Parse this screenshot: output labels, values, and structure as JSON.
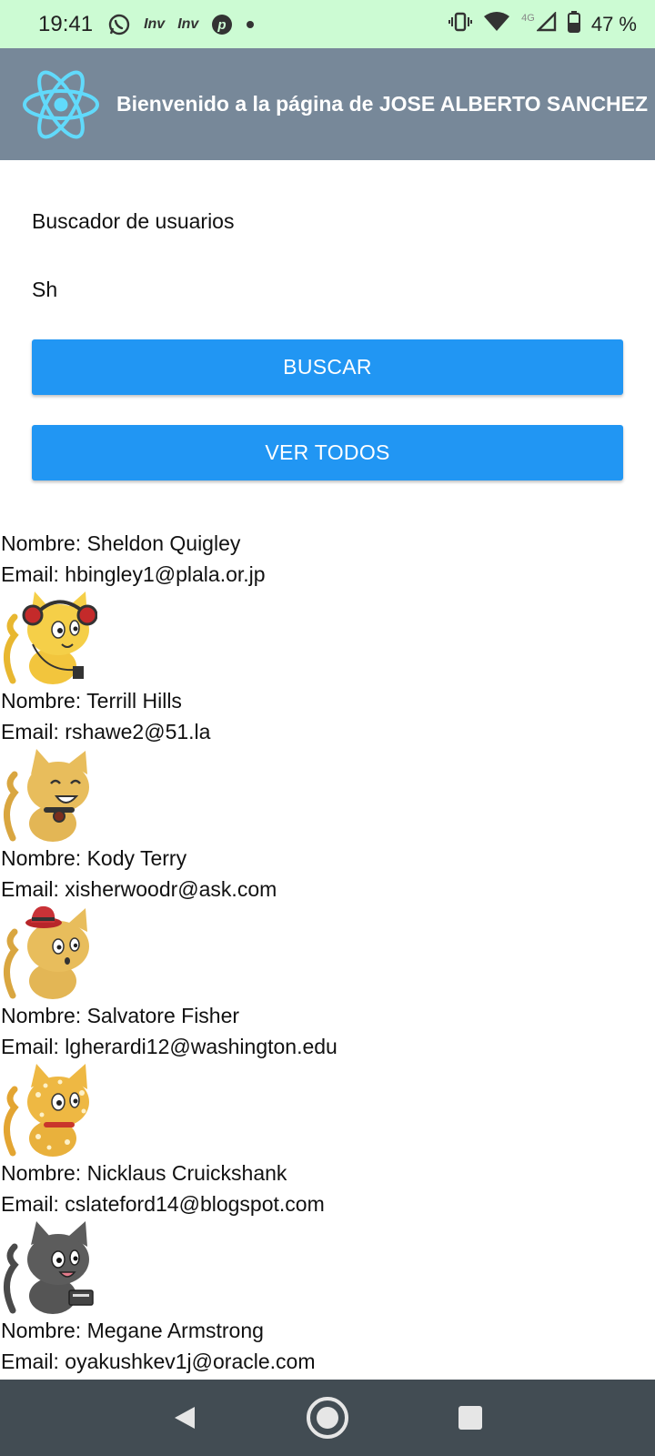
{
  "status_bar": {
    "time": "19:41",
    "notification_icons": [
      "whatsapp-icon",
      "inv-icon",
      "inv-icon",
      "pinterest-icon",
      "dot-icon"
    ],
    "inv_label": "Inv",
    "network_label": "4G",
    "battery_percent": "47 %"
  },
  "header": {
    "title": "Bienvenido a la página de JOSE ALBERTO SANCHEZ",
    "logo_color": "#61dafb",
    "background": "#778899"
  },
  "search": {
    "label": "Buscador de usuarios",
    "input_value": "Sh",
    "search_button": "BUSCAR",
    "view_all_button": "VER TODOS",
    "button_color": "#2196f3"
  },
  "users": [
    {
      "name_line": "Nombre: Sheldon Quigley",
      "email_line": "Email: hbingley1@plala.or.jp",
      "avatar": "cat-headphones"
    },
    {
      "name_line": "Nombre: Terrill Hills",
      "email_line": "Email: rshawe2@51.la",
      "avatar": "cat-smiling"
    },
    {
      "name_line": "Nombre: Kody Terry",
      "email_line": "Email: xisherwoodr@ask.com",
      "avatar": "cat-red-hat"
    },
    {
      "name_line": "Nombre: Salvatore Fisher",
      "email_line": "Email: lgherardi12@washington.edu",
      "avatar": "cat-spotted"
    },
    {
      "name_line": "Nombre: Nicklaus Cruickshank",
      "email_line": "Email: cslateford14@blogspot.com",
      "avatar": "cat-gray"
    },
    {
      "name_line": "Nombre: Megane Armstrong",
      "email_line": "Email: oyakushkev1j@oracle.com",
      "avatar": ""
    }
  ],
  "nav_bar": {
    "buttons": [
      "back-icon",
      "home-icon",
      "recents-icon"
    ]
  }
}
